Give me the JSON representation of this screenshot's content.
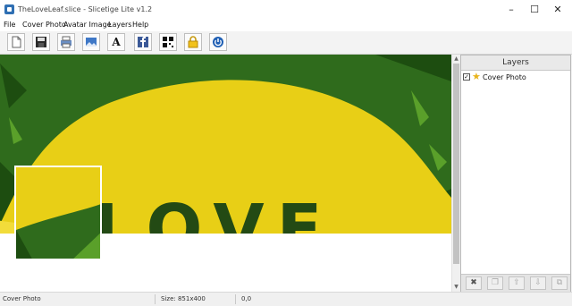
{
  "window": {
    "title": "TheLoveLeaf.slice - Slicetige Lite v1.2",
    "minimize_glyph": "–",
    "maximize_glyph": "☐",
    "close_glyph": "✕"
  },
  "menu": {
    "items": [
      "File",
      "Cover Photo",
      "Avatar Image",
      "Layers",
      "Help"
    ]
  },
  "toolbar": {
    "buttons": [
      "new-icon",
      "save-icon",
      "print-icon",
      "image-icon",
      "text-icon",
      "facebook-icon",
      "qr-code-icon",
      "lock-icon",
      "power-icon"
    ],
    "text_glyph": "A"
  },
  "canvas": {
    "cover_text": "LOVE",
    "colors": {
      "leaf": "#e8cf16",
      "grass": "#2f6b1c",
      "avatar_border": "#ffffff"
    }
  },
  "layers": {
    "title": "Layers",
    "items": [
      {
        "label": "Cover Photo",
        "checked": true,
        "check_glyph": "✓",
        "icon": "star-icon"
      }
    ],
    "footer_buttons": [
      "delete-icon",
      "duplicate-icon",
      "move-up-icon",
      "move-down-icon",
      "merge-icon"
    ],
    "footer_glyphs": [
      "✖",
      "❐",
      "⇧",
      "⇩",
      "⧉"
    ]
  },
  "status": {
    "layer": "Cover Photo",
    "size": "Size: 851x400",
    "coords": "0,0"
  },
  "colors": {
    "accent": "#2f6fb3",
    "panel_bg": "#f0f0f0"
  }
}
